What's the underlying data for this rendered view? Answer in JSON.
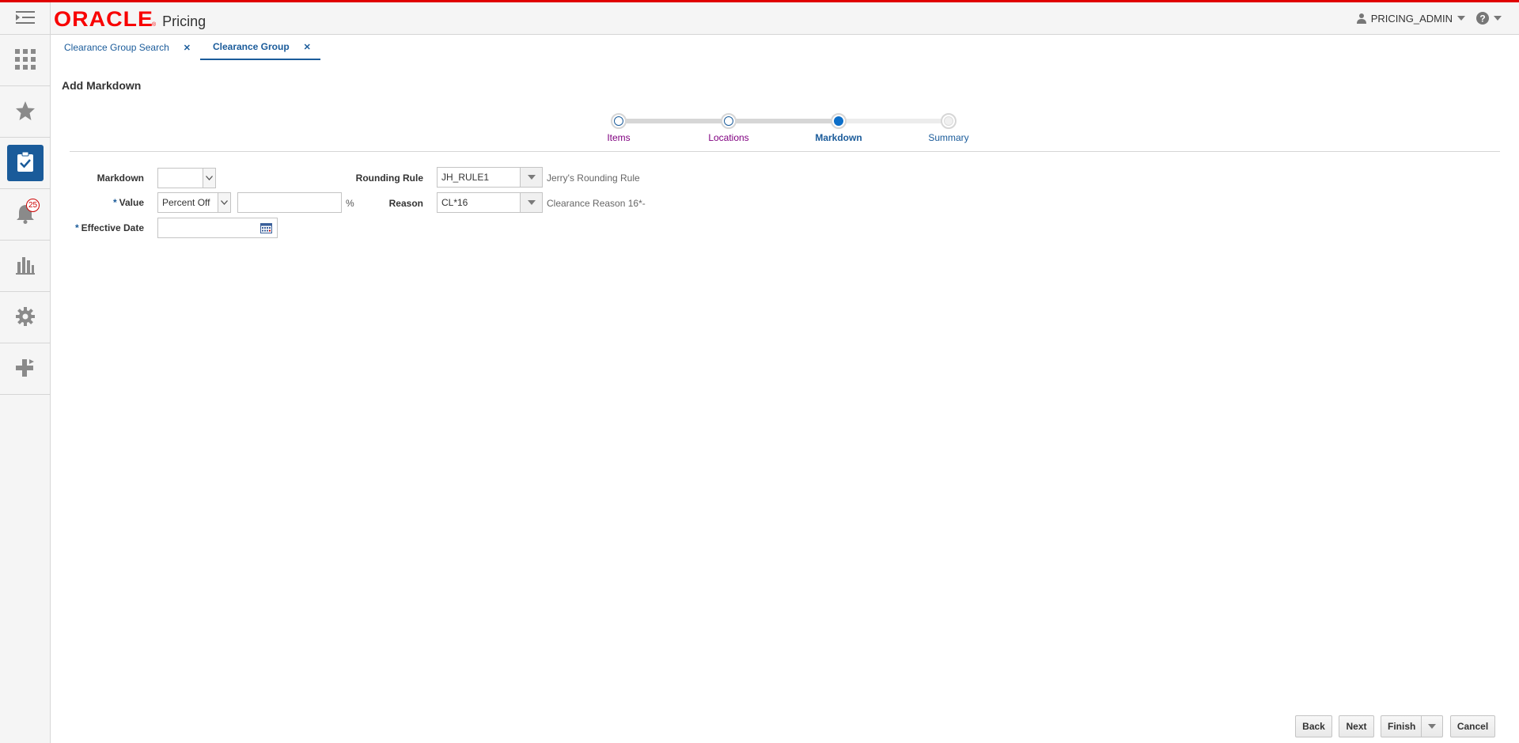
{
  "header": {
    "logo_text": "ORACLE",
    "app_name": "Pricing",
    "user_name": "PRICING_ADMIN",
    "brand_color": "#f80000",
    "accent_color": "#1a5b9a"
  },
  "rail": {
    "items": [
      {
        "icon": "apps-grid-icon"
      },
      {
        "icon": "star-icon"
      },
      {
        "icon": "task-clipboard-icon",
        "active": true
      },
      {
        "icon": "bell-icon",
        "badge": "25"
      },
      {
        "icon": "bar-chart-icon"
      },
      {
        "icon": "gear-icon"
      },
      {
        "icon": "plus-arrow-icon"
      }
    ]
  },
  "tabs": [
    {
      "label": "Clearance Group Search"
    },
    {
      "label": "Clearance Group",
      "active": true
    }
  ],
  "page": {
    "title": "Add Markdown"
  },
  "train": {
    "steps": [
      {
        "label": "Items",
        "state": "visited"
      },
      {
        "label": "Locations",
        "state": "visited"
      },
      {
        "label": "Markdown",
        "state": "current"
      },
      {
        "label": "Summary",
        "state": "future"
      }
    ]
  },
  "form": {
    "markdown_label": "Markdown",
    "markdown_value": "",
    "value_label": "Value",
    "value_type": "Percent Off",
    "value_amount": "",
    "value_unit": "%",
    "effective_date_label": "Effective Date",
    "effective_date_value": "",
    "rounding_rule_label": "Rounding Rule",
    "rounding_rule_value": "JH_RULE1",
    "rounding_rule_desc": "Jerry's Rounding Rule",
    "reason_label": "Reason",
    "reason_value": "CL*16",
    "reason_desc": "Clearance Reason 16*-",
    "required_mark": "*"
  },
  "buttons": {
    "back": "Back",
    "next": "Next",
    "finish": "Finish",
    "cancel": "Cancel"
  }
}
